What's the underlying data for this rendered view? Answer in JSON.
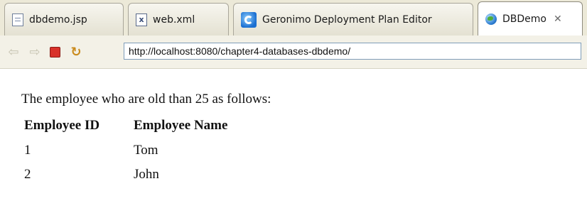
{
  "tabs": [
    {
      "label": "dbdemo.jsp",
      "icon": "jsp-file-icon"
    },
    {
      "label": "web.xml",
      "icon": "xml-file-icon"
    },
    {
      "label": "Geronimo Deployment Plan Editor",
      "icon": "geronimo-icon"
    },
    {
      "label": "DBDemo",
      "icon": "globe-icon",
      "active": true,
      "close_glyph": "✕"
    }
  ],
  "toolbar": {
    "back_glyph": "⇦",
    "forward_glyph": "⇨",
    "refresh_glyph": "↻",
    "url": "http://localhost:8080/chapter4-databases-dbdemo/"
  },
  "page": {
    "intro": "The employee who are old than 25 as follows:",
    "columns": [
      "Employee ID",
      "Employee Name"
    ],
    "rows": [
      [
        "1",
        "Tom"
      ],
      [
        "2",
        "John"
      ]
    ]
  },
  "colors": {
    "chrome_bg": "#ece9d8",
    "url_border": "#7f9db9",
    "stop_red": "#d8322a"
  }
}
